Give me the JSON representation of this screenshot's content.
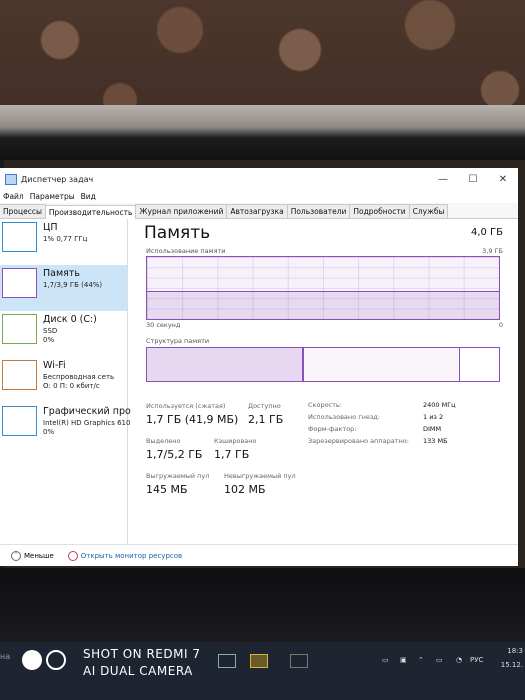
{
  "window": {
    "title": "Диспетчер задач",
    "controls": {
      "minimize": "—",
      "maximize": "☐",
      "close": "✕"
    }
  },
  "menu": [
    "Файл",
    "Параметры",
    "Вид"
  ],
  "tabs": [
    {
      "label": "Процессы",
      "active": false
    },
    {
      "label": "Производительность",
      "active": true
    },
    {
      "label": "Журнал приложений",
      "active": false
    },
    {
      "label": "Автозагрузка",
      "active": false
    },
    {
      "label": "Пользователи",
      "active": false
    },
    {
      "label": "Подробности",
      "active": false
    },
    {
      "label": "Службы",
      "active": false
    }
  ],
  "sidebar": {
    "items": [
      {
        "name": "ЦП",
        "sub1": "1% 0,77 ГГц",
        "sub2": ""
      },
      {
        "name": "Память",
        "sub1": "1,7/3,9 ГБ (44%)",
        "sub2": "",
        "selected": true
      },
      {
        "name": "Диск 0 (C:)",
        "sub1": "SSD",
        "sub2": "0%"
      },
      {
        "name": "Wi-Fi",
        "sub1": "Беспроводная сеть",
        "sub2": "О: 0 П: 0 кбит/с"
      },
      {
        "name": "Графический про",
        "sub1": "Intel(R) HD Graphics 610",
        "sub2": "0%"
      }
    ]
  },
  "main": {
    "title": "Память",
    "total": "4,0 ГБ",
    "usage_label": "Использование памяти",
    "usage_max": "3,9 ГБ",
    "time_label": "30 секунд",
    "time_end": "0",
    "usage_fraction": 0.44,
    "structure_label": "Структура памяти",
    "structure": {
      "used": 0.44,
      "modified": 0.0,
      "standby": 0.44
    },
    "stats": {
      "in_use_label": "Используется (сжатая)",
      "in_use_value": "1,7 ГБ (41,9 МБ)",
      "available_label": "Доступно",
      "available_value": "2,1 ГБ",
      "committed_label": "Выделено",
      "committed_value": "1,7/5,2 ГБ",
      "cached_label": "Кэшировано",
      "cached_value": "1,7 ГБ",
      "paged_label": "Выгружаемый пул",
      "paged_value": "145 МБ",
      "nonpaged_label": "Невыгружаемый пул",
      "nonpaged_value": "102 МБ"
    },
    "specs": [
      {
        "key": "Скорость:",
        "value": "2400 МГц"
      },
      {
        "key": "Использовано гнезд:",
        "value": "1 из 2"
      },
      {
        "key": "Форм-фактор:",
        "value": "DIMM"
      },
      {
        "key": "Зарезервировано аппаратно:",
        "value": "133 МБ"
      }
    ]
  },
  "footer": {
    "fewer": "Меньше",
    "monitor": "Открыть монитор ресурсов"
  },
  "taskbar": {
    "search_hint": "на",
    "lang": "РУС",
    "time": "18:3",
    "date": "15.12."
  },
  "watermark": {
    "line1": "SHOT ON REDMI 7",
    "line2": "AI DUAL CAMERA"
  }
}
